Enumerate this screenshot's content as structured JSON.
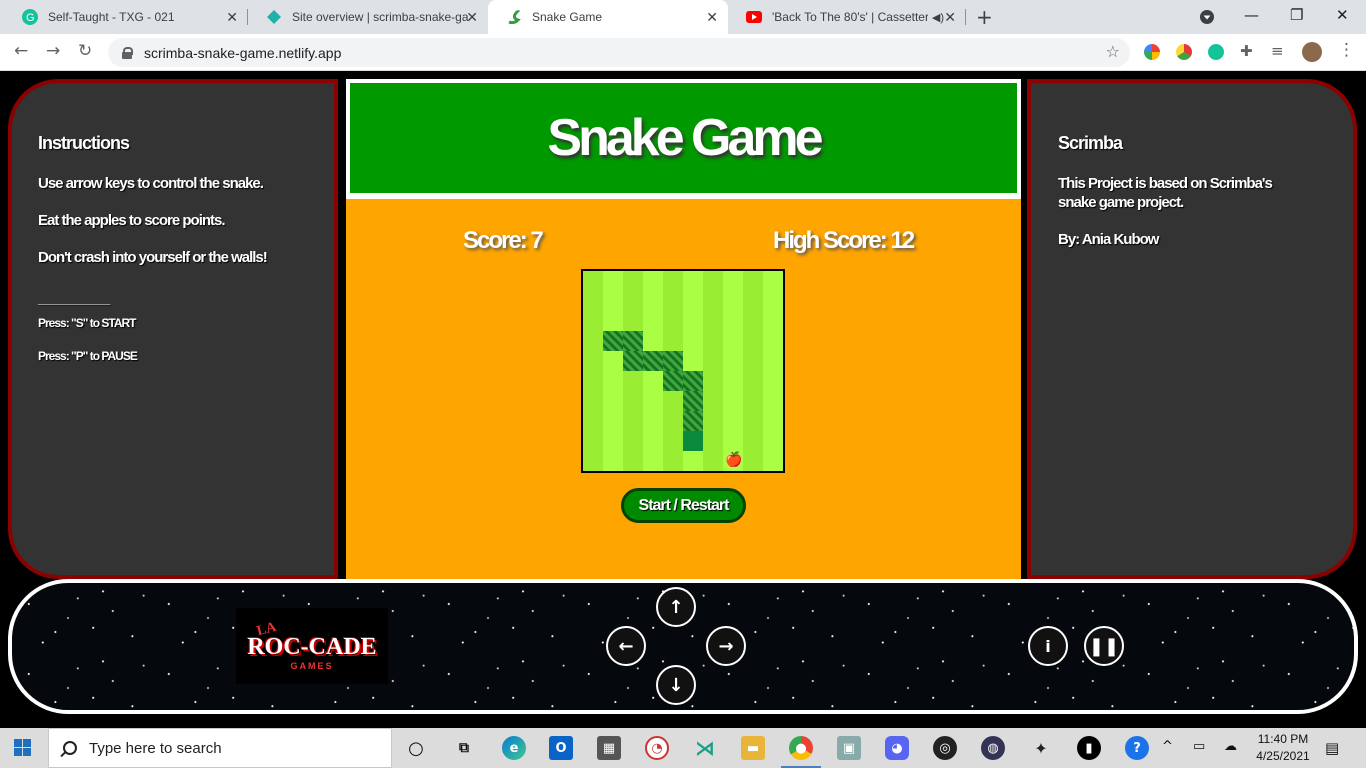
{
  "browser": {
    "tabs": [
      {
        "title": "Self-Taught - TXG - 021",
        "icon": "grammarly-icon"
      },
      {
        "title": "Site overview | scrimba-snake-ga",
        "icon": "netlify-icon"
      },
      {
        "title": "Snake Game",
        "icon": "snake-icon",
        "active": true
      },
      {
        "title": "'Back To The 80's' | Cassetter",
        "icon": "youtube-icon"
      }
    ],
    "url": "scrimba-snake-game.netlify.app"
  },
  "instructions": {
    "heading": "Instructions",
    "line1": "Use arrow keys to control the snake.",
    "line2": "Eat the apples to score points.",
    "line3": "Don't crash into yourself or the walls!",
    "divider": "__________",
    "press_start": "Press: \"S\" to START",
    "press_pause": "Press: \"P\" to PAUSE"
  },
  "credits": {
    "heading": "Scrimba",
    "description": "This Project is based on Scrimba's snake game project.",
    "author": "By: Ania Kubow"
  },
  "game": {
    "title": "Snake Game",
    "score_label": "Score: 7",
    "high_score_label": "High Score: 12",
    "start_button": "Start / Restart"
  },
  "controls": {
    "logo_top": "LA",
    "logo_main": "ROC-CADE",
    "logo_sub": "GAMES",
    "up_icon": "arrow-up-icon",
    "down_icon": "arrow-down-icon",
    "left_icon": "arrow-left-icon",
    "right_icon": "arrow-right-icon",
    "info_icon": "info-icon",
    "pause_icon": "pause-icon"
  },
  "taskbar": {
    "search_placeholder": "Type here to search",
    "time": "11:40 PM",
    "date": "4/25/2021"
  }
}
